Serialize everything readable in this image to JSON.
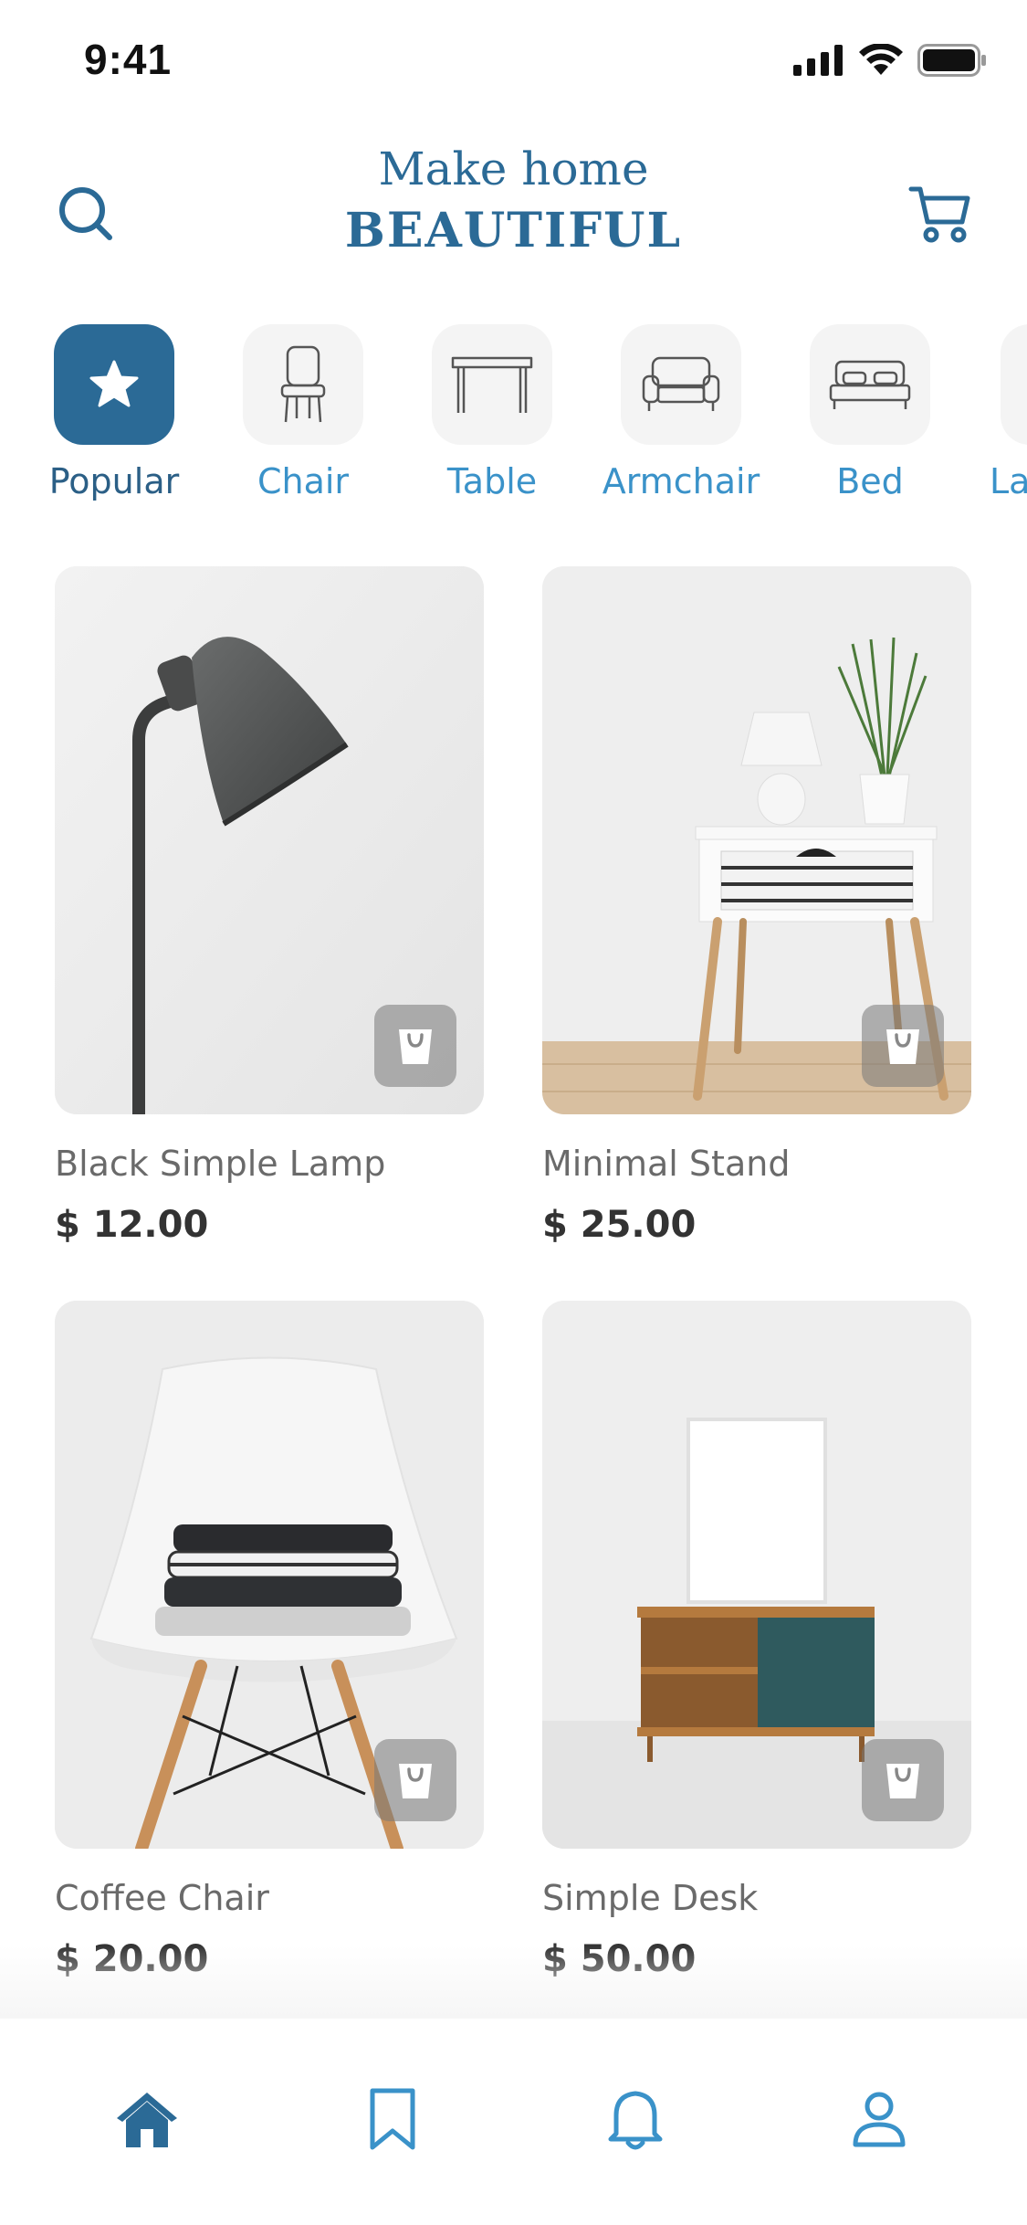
{
  "status_bar": {
    "time": "9:41",
    "icons": [
      "signal-icon",
      "wifi-icon",
      "battery-icon"
    ]
  },
  "header": {
    "title_line1": "Make home",
    "title_line2": "BEAUTIFUL",
    "left_icon": "search-icon",
    "right_icon": "cart-icon"
  },
  "categories": [
    {
      "label": "Popular",
      "icon": "star-icon",
      "active": true
    },
    {
      "label": "Chair",
      "icon": "chair-icon",
      "active": false
    },
    {
      "label": "Table",
      "icon": "table-icon",
      "active": false
    },
    {
      "label": "Armchair",
      "icon": "armchair-icon",
      "active": false
    },
    {
      "label": "Bed",
      "icon": "bed-icon",
      "active": false
    },
    {
      "label": "La",
      "icon": "lamp-icon",
      "active": false
    }
  ],
  "products": [
    {
      "name": "Black Simple Lamp",
      "price": "$ 12.00"
    },
    {
      "name": "Minimal Stand",
      "price": "$ 25.00"
    },
    {
      "name": "Coffee Chair",
      "price": "$ 20.00"
    },
    {
      "name": "Simple Desk",
      "price": "$ 50.00"
    }
  ],
  "bottom_nav": [
    {
      "icon": "home-icon",
      "active": true
    },
    {
      "icon": "bookmark-icon",
      "active": false
    },
    {
      "icon": "bell-icon",
      "active": false
    },
    {
      "icon": "profile-icon",
      "active": false
    }
  ],
  "colors": {
    "accent": "#2b6a96",
    "category_label": "#3a92c9",
    "price": "#333333",
    "name": "#6a6a6a"
  }
}
